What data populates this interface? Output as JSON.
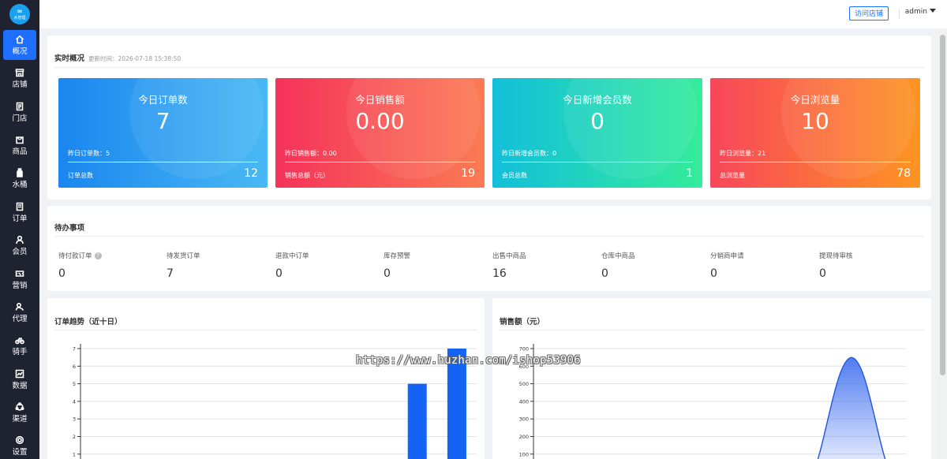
{
  "logo": {
    "text": "水管理",
    "symbol": "∞"
  },
  "sidebar": {
    "items": [
      {
        "label": "概况",
        "icon": "home-icon",
        "active": true
      },
      {
        "label": "店铺",
        "icon": "store-icon"
      },
      {
        "label": "门店",
        "icon": "document-icon"
      },
      {
        "label": "商品",
        "icon": "bag-icon"
      },
      {
        "label": "水桶",
        "icon": "bottle-icon"
      },
      {
        "label": "订单",
        "icon": "order-icon"
      },
      {
        "label": "会员",
        "icon": "user-icon"
      },
      {
        "label": "营销",
        "icon": "coupon-icon"
      },
      {
        "label": "代理",
        "icon": "agent-icon"
      },
      {
        "label": "骑手",
        "icon": "bike-icon"
      },
      {
        "label": "数据",
        "icon": "chart-icon"
      },
      {
        "label": "渠道",
        "icon": "channel-icon"
      },
      {
        "label": "设置",
        "icon": "gear-icon"
      }
    ]
  },
  "header": {
    "visit_label": "访问店铺",
    "user": "admin"
  },
  "overview": {
    "title": "实时概况",
    "updated": "更新时间：2026-07-18 15:38:50",
    "cards": [
      {
        "title": "今日订单数",
        "value": "7",
        "yesterday": "昨日订单数：5",
        "total_label": "订单总数",
        "total": "12"
      },
      {
        "title": "今日销售额",
        "value": "0.00",
        "yesterday": "昨日销售额：0.00",
        "total_label": "销售总额（元）",
        "total": "19"
      },
      {
        "title": "今日新增会员数",
        "value": "0",
        "yesterday": "昨日新增会员数：0",
        "total_label": "会员总数",
        "total": "1"
      },
      {
        "title": "今日浏览量",
        "value": "10",
        "yesterday": "昨日浏览量：21",
        "total_label": "总浏览量",
        "total": "78"
      }
    ]
  },
  "todo": {
    "title": "待办事项",
    "items": [
      {
        "label": "待付款订单",
        "value": "0"
      },
      {
        "label": "待发货订单",
        "value": "7"
      },
      {
        "label": "退款中订单",
        "value": "0"
      },
      {
        "label": "库存预警",
        "value": "0"
      },
      {
        "label": "出售中商品",
        "value": "16"
      },
      {
        "label": "仓库中商品",
        "value": "0"
      },
      {
        "label": "分销商申请",
        "value": "0"
      },
      {
        "label": "提现待审核",
        "value": "0"
      }
    ]
  },
  "chart_data": [
    {
      "type": "bar",
      "title": "订单趋势（近十日）",
      "ylim": [
        0,
        7
      ],
      "yticks": [
        "1",
        "2",
        "3",
        "4",
        "5",
        "6",
        "7"
      ],
      "values": [
        0,
        0,
        0,
        0,
        0,
        0,
        0,
        0,
        5,
        7
      ],
      "color": "#1463f5",
      "grid": true
    },
    {
      "type": "area",
      "title": "销售额（元）",
      "ylim": [
        0,
        700
      ],
      "yticks": [
        "100",
        "200",
        "300",
        "400",
        "500",
        "600",
        "700"
      ],
      "peak": 650,
      "color": "#1e56e0",
      "grid": true
    }
  ],
  "watermark": "https://www.huzhan.com/ishop53906"
}
